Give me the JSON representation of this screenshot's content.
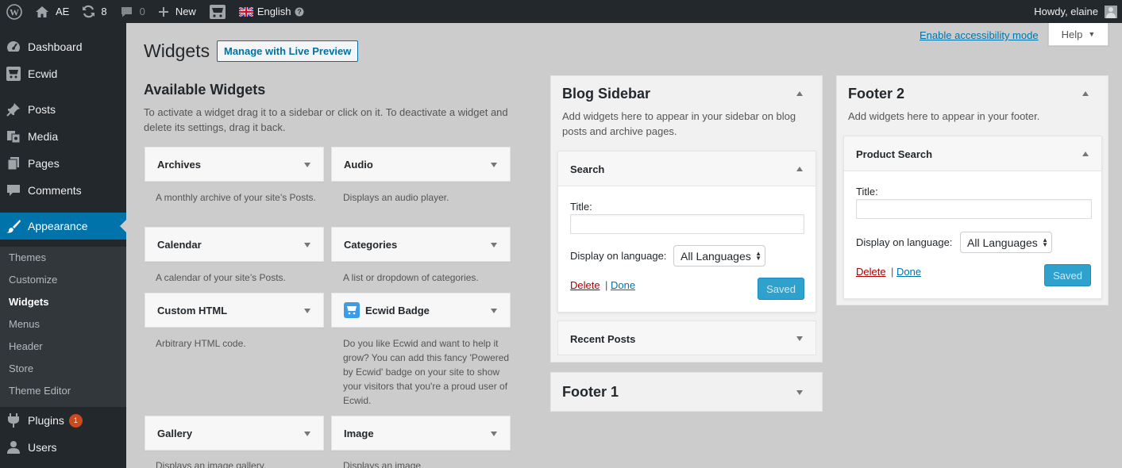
{
  "adminbar": {
    "site_name": "AE",
    "updates_count": "8",
    "comments_count": "0",
    "new_label": "New",
    "language_label": "English",
    "howdy": "Howdy, elaine"
  },
  "menu": {
    "items": [
      {
        "label": "Dashboard",
        "icon": "dashboard-icon"
      },
      {
        "label": "Ecwid",
        "icon": "ecwid-icon"
      },
      {
        "label": "Posts",
        "icon": "pin-icon"
      },
      {
        "label": "Media",
        "icon": "media-icon"
      },
      {
        "label": "Pages",
        "icon": "pages-icon"
      },
      {
        "label": "Comments",
        "icon": "comment-icon"
      },
      {
        "label": "Appearance",
        "icon": "brush-icon"
      },
      {
        "label": "Plugins",
        "icon": "plugin-icon",
        "badge": "1"
      },
      {
        "label": "Users",
        "icon": "user-icon"
      }
    ],
    "submenu": [
      "Themes",
      "Customize",
      "Widgets",
      "Menus",
      "Header",
      "Store",
      "Theme Editor"
    ]
  },
  "screen": {
    "accessibility_link": "Enable accessibility mode",
    "help_label": "Help"
  },
  "page": {
    "title": "Widgets",
    "live_preview_button": "Manage with Live Preview"
  },
  "available": {
    "title": "Available Widgets",
    "description": "To activate a widget drag it to a sidebar or click on it. To deactivate a widget and delete its settings, drag it back.",
    "widgets": [
      {
        "name": "Archives",
        "desc": "A monthly archive of your site’s Posts."
      },
      {
        "name": "Audio",
        "desc": "Displays an audio player."
      },
      {
        "name": "Calendar",
        "desc": "A calendar of your site’s Posts."
      },
      {
        "name": "Categories",
        "desc": "A list or dropdown of categories."
      },
      {
        "name": "Custom HTML",
        "desc": "Arbitrary HTML code."
      },
      {
        "name": "Ecwid Badge",
        "desc": "Do you like Ecwid and want to help it grow? You can add this fancy 'Powered by Ecwid' badge on your site to show your visitors that you're a proud user of Ecwid."
      },
      {
        "name": "Gallery",
        "desc": "Displays an image gallery."
      },
      {
        "name": "Image",
        "desc": "Displays an image."
      }
    ]
  },
  "blog_sidebar": {
    "title": "Blog Sidebar",
    "description": "Add widgets here to appear in your sidebar on blog posts and archive pages.",
    "search_widget": {
      "title": "Search",
      "title_label": "Title:",
      "title_value": "",
      "language_label": "Display on language:",
      "language_value": "All Languages",
      "delete_label": "Delete",
      "separator": "|",
      "done_label": "Done",
      "saved_label": "Saved"
    },
    "recent_posts_title": "Recent Posts"
  },
  "footer1": {
    "title": "Footer 1"
  },
  "footer2": {
    "title": "Footer 2",
    "description": "Add widgets here to appear in your footer.",
    "product_search_widget": {
      "title": "Product Search",
      "title_label": "Title:",
      "title_value": "",
      "language_label": "Display on language:",
      "language_value": "All Languages",
      "delete_label": "Delete",
      "separator": "|",
      "done_label": "Done",
      "saved_label": "Saved"
    }
  }
}
